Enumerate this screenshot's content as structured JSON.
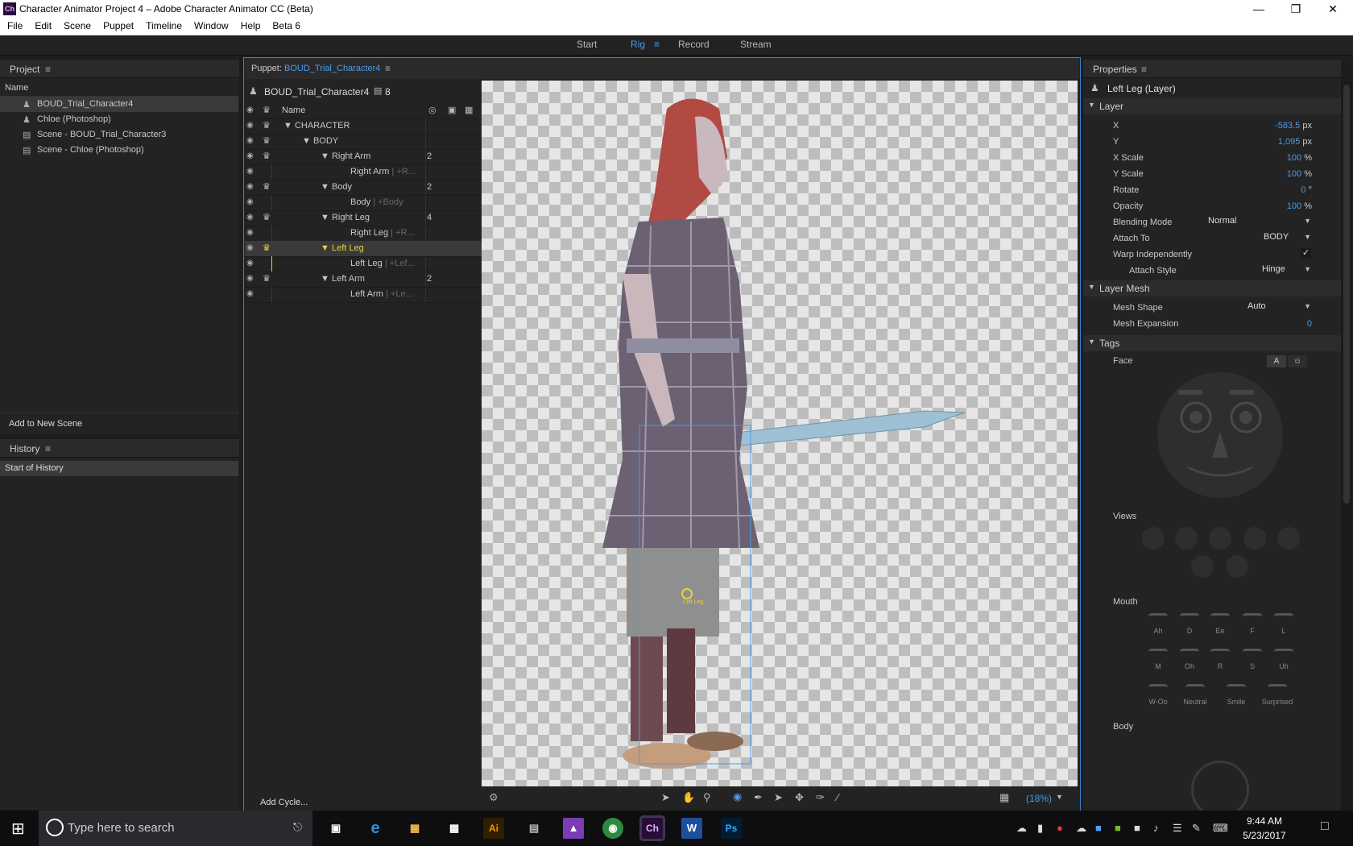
{
  "window": {
    "app_icon": "Ch",
    "title": "Character Animator Project 4 – Adobe Character Animator CC (Beta)"
  },
  "menu": [
    "File",
    "Edit",
    "Scene",
    "Puppet",
    "Timeline",
    "Window",
    "Help",
    "Beta 6"
  ],
  "workspace_tabs": [
    {
      "label": "Start",
      "active": false
    },
    {
      "label": "Rig",
      "active": true
    },
    {
      "label": "Record",
      "active": false
    },
    {
      "label": "Stream",
      "active": false
    }
  ],
  "project": {
    "title": "Project",
    "column_name": "Name",
    "items": [
      {
        "icon": "puppet-icon",
        "label": "BOUD_Trial_Character4",
        "selected": true
      },
      {
        "icon": "puppet-icon",
        "label": "Chloe (Photoshop)",
        "selected": false
      },
      {
        "icon": "scene-icon",
        "label": "Scene - BOUD_Trial_Character3",
        "selected": false
      },
      {
        "icon": "scene-icon",
        "label": "Scene - Chloe (Photoshop)",
        "selected": false
      }
    ],
    "add_to_scene": "Add to New Scene"
  },
  "history": {
    "title": "History",
    "items": [
      "Start of History"
    ]
  },
  "puppet": {
    "title_prefix": "Puppet:",
    "title_name": "BOUD_Trial_Character4",
    "root_name": "BOUD_Trial_Character4",
    "root_count": "8",
    "column_name": "Name",
    "rows": [
      {
        "name": "CHARACTER",
        "suffix": "",
        "count": "",
        "crown": true,
        "arrow": true,
        "indent": 0,
        "selected": false
      },
      {
        "name": "BODY",
        "suffix": "",
        "count": "",
        "crown": true,
        "arrow": true,
        "indent": 1,
        "selected": false
      },
      {
        "name": "Right Arm",
        "suffix": "",
        "count": "2",
        "crown": true,
        "arrow": true,
        "indent": 2,
        "selected": false
      },
      {
        "name": "Right Arm",
        "suffix": "| +R...",
        "count": "",
        "crown": false,
        "arrow": false,
        "indent": 3,
        "selected": false
      },
      {
        "name": "Body",
        "suffix": "",
        "count": "2",
        "crown": true,
        "arrow": true,
        "indent": 2,
        "selected": false
      },
      {
        "name": "Body",
        "suffix": "| +Body",
        "count": "",
        "crown": false,
        "arrow": false,
        "indent": 3,
        "selected": false
      },
      {
        "name": "Right Leg",
        "suffix": "",
        "count": "4",
        "crown": true,
        "arrow": true,
        "indent": 2,
        "selected": false
      },
      {
        "name": "Right Leg",
        "suffix": "| +R...",
        "count": "",
        "crown": false,
        "arrow": false,
        "indent": 3,
        "selected": false
      },
      {
        "name": "Left Leg",
        "suffix": "",
        "count": "",
        "crown": true,
        "arrow": true,
        "indent": 2,
        "selected": true
      },
      {
        "name": "Left Leg",
        "suffix": "| +Lef...",
        "count": "",
        "crown": false,
        "arrow": false,
        "indent": 3,
        "selected": false
      },
      {
        "name": "Left Arm",
        "suffix": "",
        "count": "2",
        "crown": true,
        "arrow": true,
        "indent": 2,
        "selected": false
      },
      {
        "name": "Left Arm",
        "suffix": "| +Le...",
        "count": "",
        "crown": false,
        "arrow": false,
        "indent": 3,
        "selected": false
      }
    ],
    "add_cycle": "Add Cycle...",
    "canvas_label": "Left Leg",
    "zoom": "(18%)"
  },
  "properties": {
    "title": "Properties",
    "subject": "Left Leg (Layer)",
    "layer_section": "Layer",
    "fields": [
      {
        "label": "X",
        "value": "-583.5",
        "unit": "px"
      },
      {
        "label": "Y",
        "value": "1,095",
        "unit": "px"
      },
      {
        "label": "X Scale",
        "value": "100",
        "unit": "%"
      },
      {
        "label": "Y Scale",
        "value": "100",
        "unit": "%"
      },
      {
        "label": "Rotate",
        "value": "0",
        "unit": "°"
      },
      {
        "label": "Opacity",
        "value": "100",
        "unit": "%"
      }
    ],
    "blending_mode_label": "Blending Mode",
    "blending_mode_value": "Normal",
    "attach_to_label": "Attach To",
    "attach_to_value": "BODY",
    "warp_label": "Warp Independently",
    "warp_check": "✓",
    "attach_style_label": "Attach Style",
    "attach_style_value": "Hinge",
    "mesh_section": "Layer Mesh",
    "mesh_shape_label": "Mesh Shape",
    "mesh_shape_value": "Auto",
    "mesh_expansion_label": "Mesh Expansion",
    "mesh_expansion_value": "0",
    "tags_section": "Tags",
    "face_label": "Face",
    "face_btn": "A",
    "views_label": "Views",
    "mouth_label": "Mouth",
    "mouth_shapes": [
      "Ah",
      "D",
      "Ee",
      "F",
      "L",
      "M",
      "Oh",
      "R",
      "S",
      "Uh",
      "W-Oo",
      "Neutral",
      "Smile",
      "Surprised"
    ],
    "body_label": "Body"
  },
  "taskbar": {
    "search_placeholder": "Type here to search",
    "time": "9:44 AM",
    "date": "5/23/2017",
    "apps": [
      "Ai",
      "Ch",
      "Ps"
    ]
  },
  "colors": {
    "accent": "#4a9ce8",
    "selected_layer": "#e8d23a",
    "panel_bg": "#232323"
  }
}
